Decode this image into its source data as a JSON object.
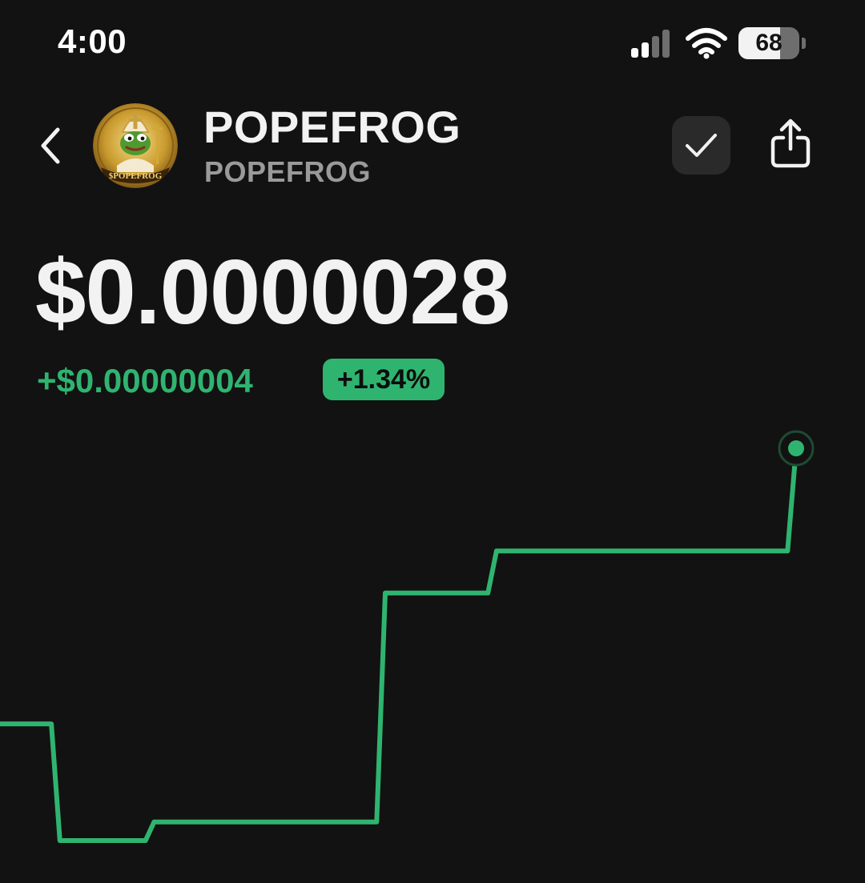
{
  "status_bar": {
    "time": "4:00",
    "battery_level": "68",
    "battery_fraction": 0.68,
    "icons": [
      "signal-icon",
      "wifi-icon",
      "battery-icon"
    ]
  },
  "header": {
    "back_icon": "chevron-left-icon",
    "token_name": "POPEFROG",
    "token_symbol": "POPEFROG",
    "logo_text": "$POPEFROG",
    "watch_icon": "checkmark-icon",
    "share_icon": "share-icon"
  },
  "price": {
    "value": "$0.0000028",
    "change": "+$0.00000004",
    "change_percent": "+1.34%"
  },
  "colors": {
    "background": "#121212",
    "text": "#f2f2f2",
    "secondary_text": "#9a9a9a",
    "accent_green": "#2fb470",
    "button_bg": "#2a2a2a"
  },
  "chart_data": {
    "type": "line",
    "style": "step",
    "axes_shown": false,
    "grid": false,
    "x": [
      0,
      6,
      7,
      17,
      18,
      44,
      45,
      57,
      58,
      92,
      93
    ],
    "values": [
      0.41,
      0.41,
      0.16,
      0.16,
      0.2,
      0.2,
      0.69,
      0.69,
      0.78,
      0.78,
      1.0
    ],
    "end_marker": true
  }
}
